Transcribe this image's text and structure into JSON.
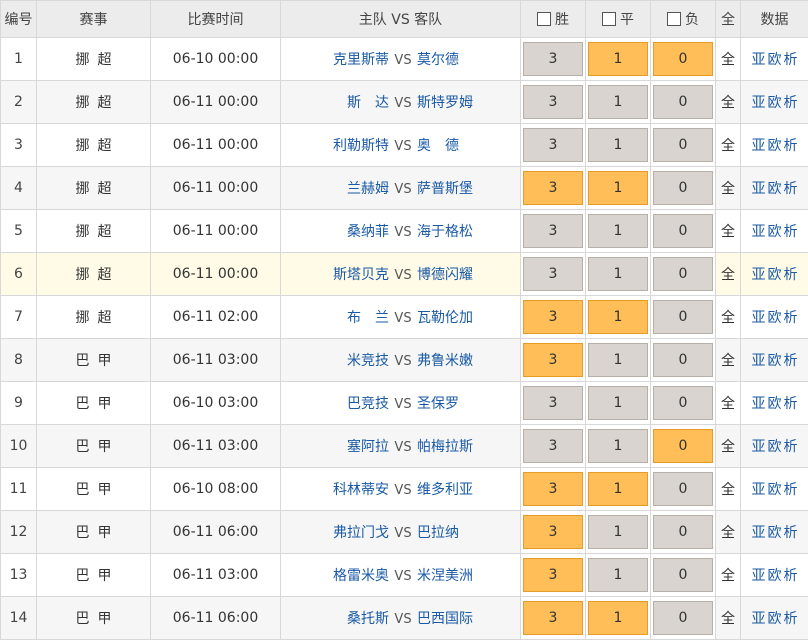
{
  "headers": {
    "no": "编号",
    "league": "赛事",
    "time": "比赛时间",
    "match": "主队 VS 客队",
    "win": "胜",
    "draw": "平",
    "lose": "负",
    "all": "全",
    "data": "数据"
  },
  "colors": {
    "selected": "#ffbe57",
    "unselected": "#d9d4cf",
    "team_link": "#1a5aa6"
  },
  "rows": [
    {
      "no": "1",
      "league": "挪超",
      "time": "06-10 00:00",
      "home": "克里斯蒂",
      "vs": "VS",
      "away": "莫尔德",
      "w": "3",
      "d": "1",
      "l": "0",
      "wSel": false,
      "dSel": true,
      "lSel": true,
      "all": "全",
      "asia": "亚",
      "euro": "欧",
      "anal": "析"
    },
    {
      "no": "2",
      "league": "挪超",
      "time": "06-11 00:00",
      "home": "斯　达",
      "vs": "VS",
      "away": "斯特罗姆",
      "w": "3",
      "d": "1",
      "l": "0",
      "wSel": false,
      "dSel": false,
      "lSel": false,
      "all": "全",
      "asia": "亚",
      "euro": "欧",
      "anal": "析"
    },
    {
      "no": "3",
      "league": "挪超",
      "time": "06-11 00:00",
      "home": "利勒斯特",
      "vs": "VS",
      "away": "奥　德",
      "w": "3",
      "d": "1",
      "l": "0",
      "wSel": false,
      "dSel": false,
      "lSel": false,
      "all": "全",
      "asia": "亚",
      "euro": "欧",
      "anal": "析"
    },
    {
      "no": "4",
      "league": "挪超",
      "time": "06-11 00:00",
      "home": "兰赫姆",
      "vs": "VS",
      "away": "萨普斯堡",
      "w": "3",
      "d": "1",
      "l": "0",
      "wSel": true,
      "dSel": true,
      "lSel": false,
      "all": "全",
      "asia": "亚",
      "euro": "欧",
      "anal": "析"
    },
    {
      "no": "5",
      "league": "挪超",
      "time": "06-11 00:00",
      "home": "桑纳菲",
      "vs": "VS",
      "away": "海于格松",
      "w": "3",
      "d": "1",
      "l": "0",
      "wSel": false,
      "dSel": false,
      "lSel": false,
      "all": "全",
      "asia": "亚",
      "euro": "欧",
      "anal": "析"
    },
    {
      "no": "6",
      "league": "挪超",
      "time": "06-11 00:00",
      "home": "斯塔贝克",
      "vs": "VS",
      "away": "博德闪耀",
      "w": "3",
      "d": "1",
      "l": "0",
      "wSel": false,
      "dSel": false,
      "lSel": false,
      "all": "全",
      "asia": "亚",
      "euro": "欧",
      "anal": "析"
    },
    {
      "no": "7",
      "league": "挪超",
      "time": "06-11 02:00",
      "home": "布　兰",
      "vs": "VS",
      "away": "瓦勒伦加",
      "w": "3",
      "d": "1",
      "l": "0",
      "wSel": true,
      "dSel": true,
      "lSel": false,
      "all": "全",
      "asia": "亚",
      "euro": "欧",
      "anal": "析"
    },
    {
      "no": "8",
      "league": "巴甲",
      "time": "06-11 03:00",
      "home": "米竞技",
      "vs": "VS",
      "away": "弗鲁米嫩",
      "w": "3",
      "d": "1",
      "l": "0",
      "wSel": true,
      "dSel": false,
      "lSel": false,
      "all": "全",
      "asia": "亚",
      "euro": "欧",
      "anal": "析"
    },
    {
      "no": "9",
      "league": "巴甲",
      "time": "06-10 03:00",
      "home": "巴竞技",
      "vs": "VS",
      "away": "圣保罗",
      "w": "3",
      "d": "1",
      "l": "0",
      "wSel": false,
      "dSel": false,
      "lSel": false,
      "all": "全",
      "asia": "亚",
      "euro": "欧",
      "anal": "析"
    },
    {
      "no": "10",
      "league": "巴甲",
      "time": "06-11 03:00",
      "home": "塞阿拉",
      "vs": "VS",
      "away": "帕梅拉斯",
      "w": "3",
      "d": "1",
      "l": "0",
      "wSel": false,
      "dSel": false,
      "lSel": true,
      "all": "全",
      "asia": "亚",
      "euro": "欧",
      "anal": "析"
    },
    {
      "no": "11",
      "league": "巴甲",
      "time": "06-10 08:00",
      "home": "科林蒂安",
      "vs": "VS",
      "away": "维多利亚",
      "w": "3",
      "d": "1",
      "l": "0",
      "wSel": true,
      "dSel": true,
      "lSel": false,
      "all": "全",
      "asia": "亚",
      "euro": "欧",
      "anal": "析"
    },
    {
      "no": "12",
      "league": "巴甲",
      "time": "06-11 06:00",
      "home": "弗拉门戈",
      "vs": "VS",
      "away": "巴拉纳",
      "w": "3",
      "d": "1",
      "l": "0",
      "wSel": true,
      "dSel": false,
      "lSel": false,
      "all": "全",
      "asia": "亚",
      "euro": "欧",
      "anal": "析"
    },
    {
      "no": "13",
      "league": "巴甲",
      "time": "06-11 03:00",
      "home": "格雷米奥",
      "vs": "VS",
      "away": "米涅美洲",
      "w": "3",
      "d": "1",
      "l": "0",
      "wSel": true,
      "dSel": false,
      "lSel": false,
      "all": "全",
      "asia": "亚",
      "euro": "欧",
      "anal": "析"
    },
    {
      "no": "14",
      "league": "巴甲",
      "time": "06-11 06:00",
      "home": "桑托斯",
      "vs": "VS",
      "away": "巴西国际",
      "w": "3",
      "d": "1",
      "l": "0",
      "wSel": true,
      "dSel": true,
      "lSel": false,
      "all": "全",
      "asia": "亚",
      "euro": "欧",
      "anal": "析"
    }
  ]
}
